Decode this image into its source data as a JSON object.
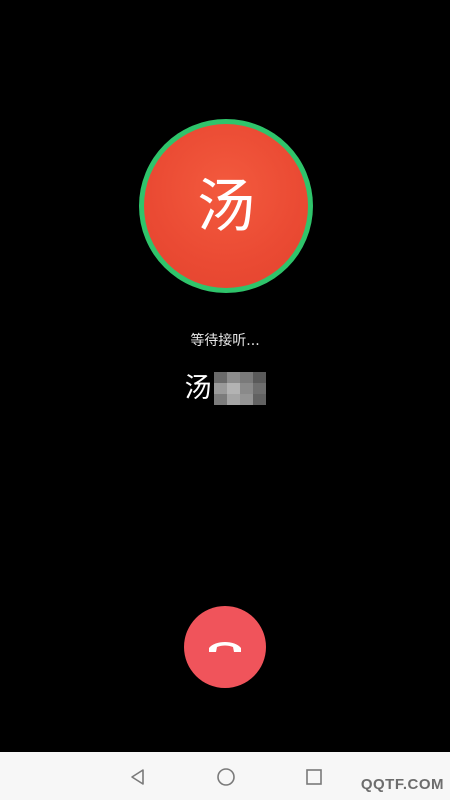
{
  "call": {
    "avatar_char": "汤",
    "status": "等待接听...",
    "contact_name_visible": "汤",
    "contact_name_redacted": true
  },
  "colors": {
    "avatar_ring": "#2fc46b",
    "avatar_fill": "#ea4a33",
    "hangup": "#f0545b",
    "background": "#000000",
    "navbar": "#f7f7f7"
  },
  "actions": {
    "hangup_icon": "phone-hangup-icon"
  },
  "navbar": {
    "back_icon": "back-triangle-icon",
    "home_icon": "home-circle-icon",
    "recents_icon": "recents-square-icon"
  },
  "watermark": {
    "text": "QQTF.COM"
  }
}
